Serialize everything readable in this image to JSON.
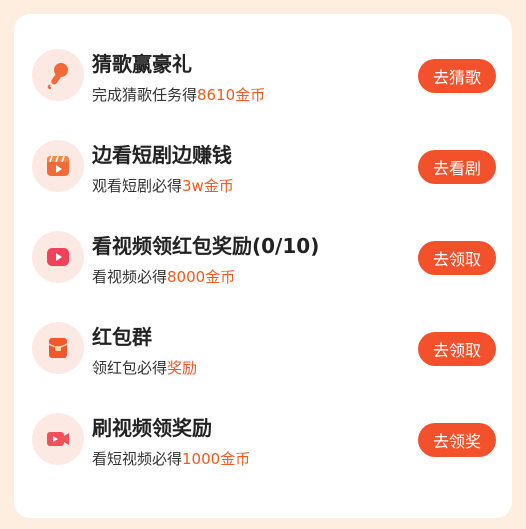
{
  "tasks": [
    {
      "title": "猜歌赢豪礼",
      "desc_prefix": "完成猜歌任务得",
      "desc_highlight": "8610金币",
      "button_label": "去猜歌",
      "icon": "microphone-icon"
    },
    {
      "title": "边看短剧边赚钱",
      "desc_prefix": "观看短剧必得",
      "desc_highlight": "3w金币",
      "button_label": "去看剧",
      "icon": "clapperboard-icon"
    },
    {
      "title": "看视频领红包奖励(0/10)",
      "desc_prefix": "看视频必得",
      "desc_highlight": "8000金币",
      "button_label": "去领取",
      "icon": "video-play-icon"
    },
    {
      "title": "红包群",
      "desc_prefix": "领红包必得",
      "desc_highlight": "奖励",
      "button_label": "去领取",
      "icon": "red-envelope-icon"
    },
    {
      "title": "刷视频领奖励",
      "desc_prefix": "看短视频必得",
      "desc_highlight": "1000金币",
      "button_label": "去领奖",
      "icon": "video-camera-icon"
    }
  ],
  "colors": {
    "page_background": "#fdeee0",
    "button": "#f2512b",
    "highlight_text": "#f05a20",
    "icon_circle": "#fde9e4"
  }
}
